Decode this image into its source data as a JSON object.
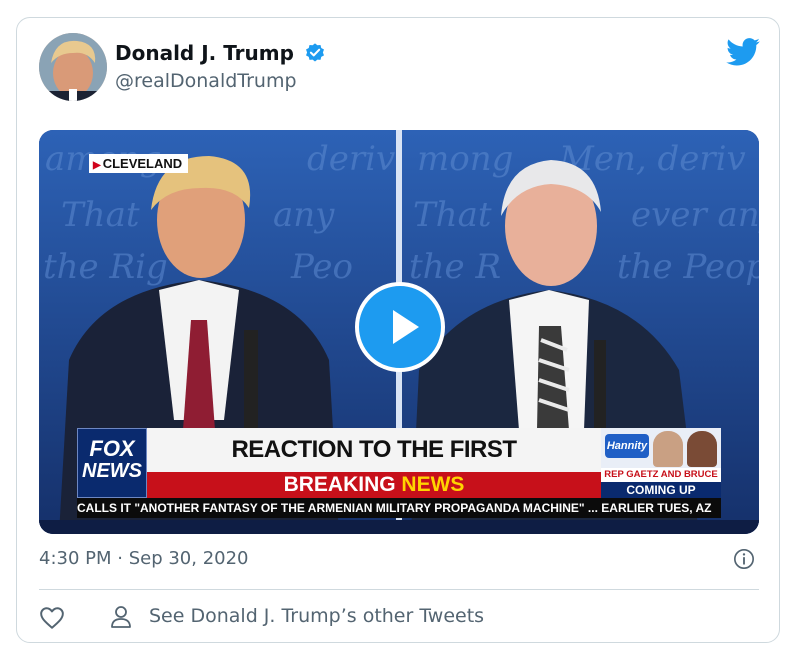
{
  "tweet": {
    "display_name": "Donald J. Trump",
    "handle": "@realDonaldTrump",
    "timestamp": "4:30 PM · Sep 30, 2020",
    "see_more": "See Donald J. Trump’s other Tweets"
  },
  "video": {
    "location_tag": "CLEVELAND",
    "network_top": "FOX",
    "network_bottom": "NEWS",
    "headline": "REACTION TO THE FIRST PRESIDENTIAL DEBATE",
    "breaking_1": "BREAKING",
    "breaking_2": "NEWS",
    "promo_show": "Hannity",
    "promo_guests": "REP GAETZ AND BRUCE",
    "promo_status": "COMING UP",
    "ticker": "CALLS IT \"ANOTHER FANTASY OF THE ARMENIAN MILITARY PROPAGANDA MACHINE\" ...   EARLIER TUES, AZ"
  },
  "icons": {
    "verified": "verified-badge-icon",
    "twitter": "twitter-bird-icon",
    "play": "play-icon",
    "info": "info-icon",
    "like": "heart-icon",
    "profile": "person-icon"
  },
  "colors": {
    "accent": "#1d9bf0",
    "secondary_text": "#536471",
    "border": "#cfd9de",
    "breaking_red": "#c7101a"
  }
}
